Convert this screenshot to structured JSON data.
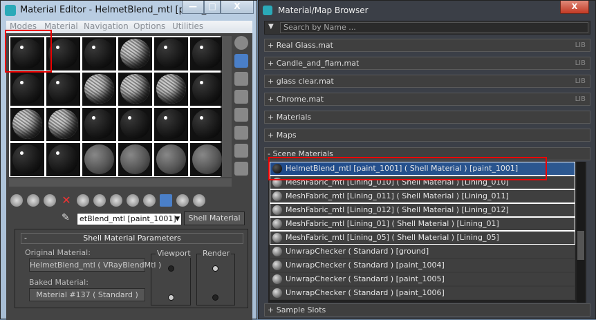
{
  "editor": {
    "title": "Material Editor - HelmetBlend_mtl [paint_...",
    "menu": [
      "Modes",
      "Material",
      "Navigation",
      "Options",
      "Utilities"
    ],
    "slots": [
      "dark",
      "dark",
      "dark",
      "tex",
      "dark",
      "dark",
      "dark",
      "dark",
      "tex",
      "tex",
      "tex",
      "dark",
      "tex",
      "tex",
      "dark",
      "dark",
      "dark",
      "dark",
      "dark",
      "dark",
      "gray",
      "gray",
      "gray",
      "gray"
    ],
    "material_name": "etBlend_mtl [paint_1001]",
    "type_button": "Shell Material",
    "params": {
      "header": "Shell Material Parameters",
      "collapse": "-",
      "original_label": "Original Material:",
      "original_value": "HelmetBlend_mtl  ( VRayBlendMtl )",
      "baked_label": "Baked Material:",
      "baked_value": "Material #137  ( Standard )",
      "viewport_label": "Viewport",
      "render_label": "Render",
      "viewport_selected": "baked",
      "render_selected": "original"
    }
  },
  "browser": {
    "title": "Material/Map Browser",
    "search_placeholder": "Search by Name ...",
    "rollouts": [
      {
        "label": "+ Real Glass.mat",
        "badge": "LIB"
      },
      {
        "label": "+ Candle_and_flam.mat",
        "badge": "LIB"
      },
      {
        "label": "+ glass clear.mat",
        "badge": "LIB"
      },
      {
        "label": "+ Chrome.mat",
        "badge": "LIB"
      },
      {
        "label": "+ Materials"
      },
      {
        "label": "+ Maps"
      },
      {
        "label": "- Scene Materials"
      }
    ],
    "scene_materials": [
      "HelmetBlend_mtl [paint_1001]  ( Shell Material )  [paint_1001]",
      "MeshFabric_mtl [Lining_010]  ( Shell Material )  [Lining_010]",
      "MeshFabric_mtl [Lining_011]  ( Shell Material )  [Lining_011]",
      "MeshFabric_mtl [Lining_012]  ( Shell Material )  [Lining_012]",
      "MeshFabric_mtl [Lining_01]  ( Shell Material )  [Lining_01]",
      "MeshFabric_mtl [Lining_05]  ( Shell Material )  [Lining_05]",
      "UnwrapChecker  ( Standard )  [ground]",
      "UnwrapChecker  ( Standard )  [paint_1004]",
      "UnwrapChecker  ( Standard )  [paint_1005]",
      "UnwrapChecker  ( Standard )  [paint_1006]"
    ],
    "sample_slots": "+ Sample Slots"
  },
  "window_buttons": {
    "minimize": "—",
    "maximize": "□",
    "close": "X"
  }
}
